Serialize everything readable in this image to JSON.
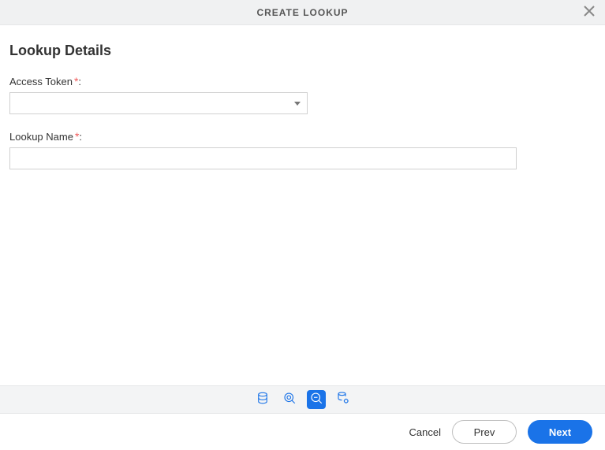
{
  "header": {
    "title": "CREATE LOOKUP"
  },
  "section": {
    "title": "Lookup Details",
    "accessTokenLabel": "Access Token",
    "accessTokenColon": ":",
    "accessTokenValue": "",
    "lookupNameLabel": "Lookup Name",
    "lookupNameColon": ":",
    "lookupNameValue": ""
  },
  "steps": {
    "items": [
      {
        "name": "source-db"
      },
      {
        "name": "source-gear"
      },
      {
        "name": "lookup-details"
      },
      {
        "name": "target-db"
      }
    ],
    "activeIndex": 2
  },
  "actions": {
    "cancel": "Cancel",
    "prev": "Prev",
    "next": "Next"
  },
  "colors": {
    "primary": "#1a73e8",
    "required": "#f05a5a",
    "headerBg": "#f0f1f2"
  }
}
